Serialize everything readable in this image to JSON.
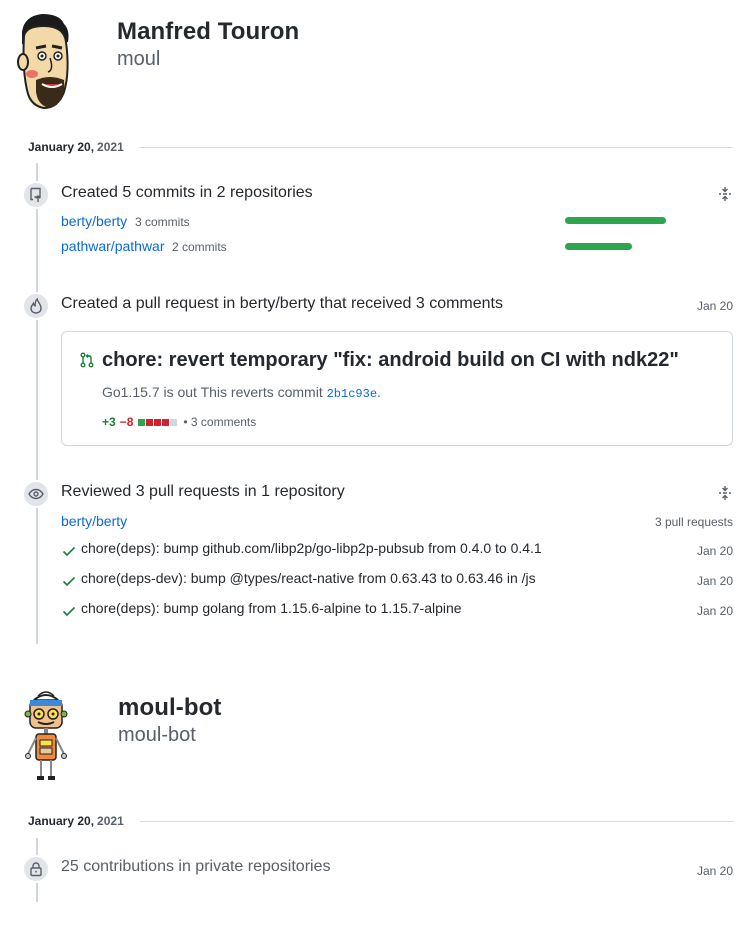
{
  "user1": {
    "name": "Manfred Touron",
    "login": "moul",
    "date_month_day": "January 20,",
    "date_year": "2021",
    "commits": {
      "title": "Created 5 commits in 2 repositories",
      "repos": [
        {
          "name": "berty/berty",
          "count": "3 commits",
          "fraction": 0.6
        },
        {
          "name": "pathwar/pathwar",
          "count": "2 commits",
          "fraction": 0.4
        }
      ]
    },
    "pull_request": {
      "title": "Created a pull request in berty/berty that received 3 comments",
      "date": "Jan 20",
      "pr_title": "chore: revert temporary \"fix: android build on CI with ndk22\"",
      "body_text": "Go1.15.7 is out This reverts commit ",
      "commit_sha": "2b1c93e",
      "body_end": ".",
      "additions": "+3",
      "deletions": "−8",
      "comments": "• 3 comments"
    },
    "reviews": {
      "title": "Reviewed 3 pull requests in 1 repository",
      "repo": "berty/berty",
      "count": "3 pull requests",
      "items": [
        {
          "title": "chore(deps): bump github.com/libp2p/go-libp2p-pubsub from 0.4.0 to 0.4.1",
          "date": "Jan 20"
        },
        {
          "title": "chore(deps-dev): bump @types/react-native from 0.63.43 to 0.63.46 in /js",
          "date": "Jan 20"
        },
        {
          "title": "chore(deps): bump golang from 1.15.6-alpine to 1.15.7-alpine",
          "date": "Jan 20"
        }
      ]
    }
  },
  "user2": {
    "name": "moul-bot",
    "login": "moul-bot",
    "date_month_day": "January 20,",
    "date_year": "2021",
    "private": {
      "title": "25 contributions in private repositories",
      "date": "Jan 20"
    }
  },
  "colors": {
    "link": "#0969da",
    "green": "#2da44e",
    "red": "#cf222e",
    "muted": "#57606a"
  }
}
